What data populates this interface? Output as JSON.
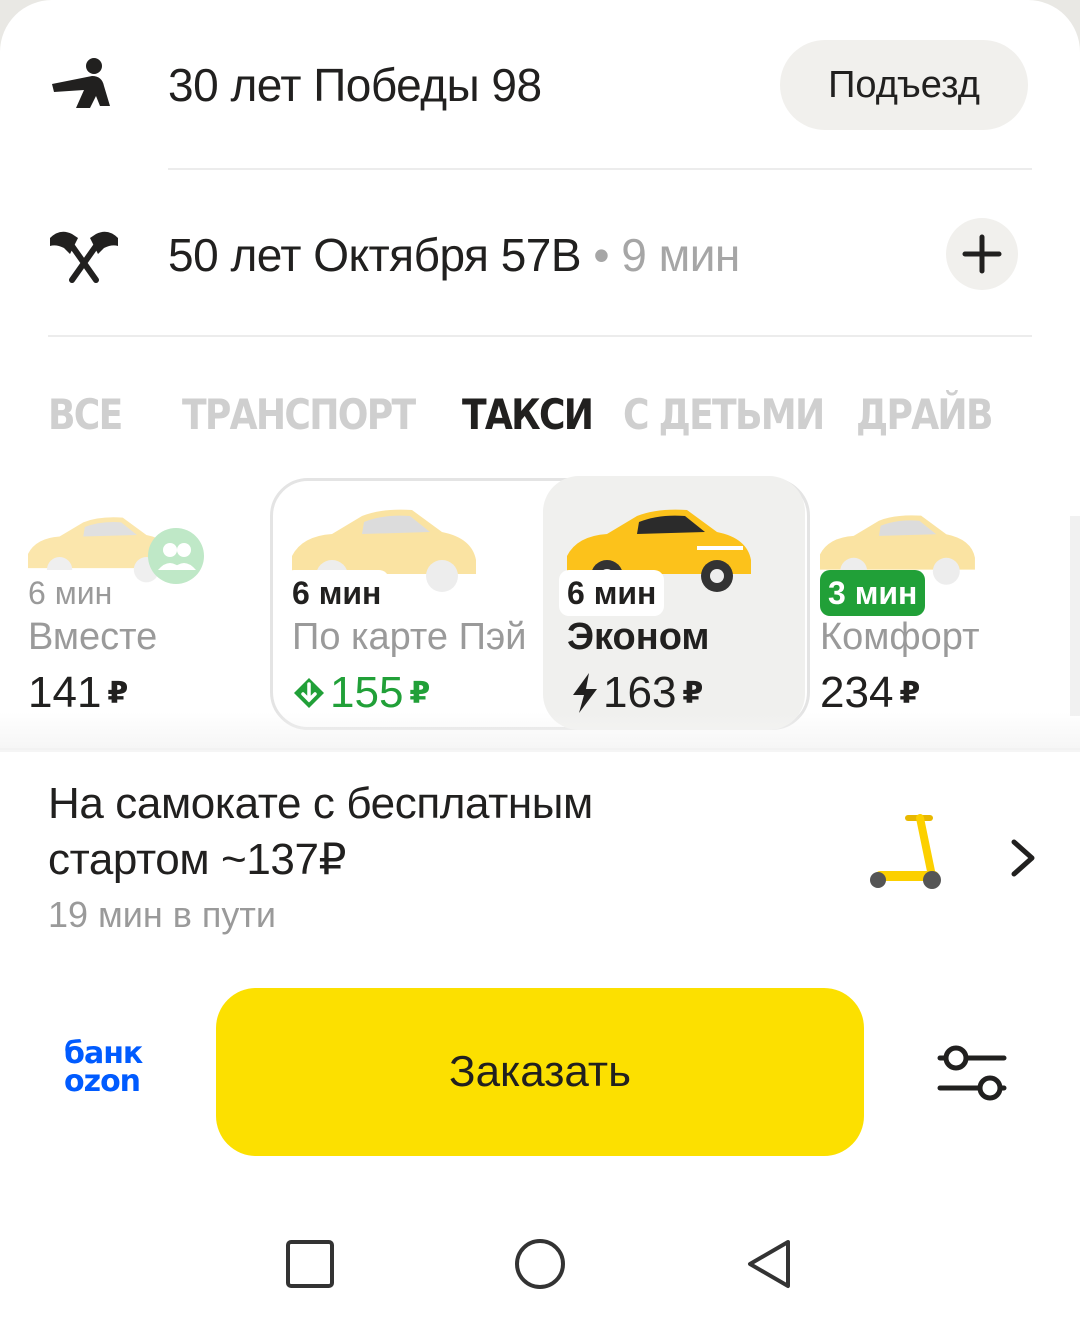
{
  "route": {
    "from": {
      "address": "30 лет Победы 98",
      "action": "Подъезд"
    },
    "to": {
      "address": "50 лет Октября 57В",
      "separator": "•",
      "eta": "9 мин"
    }
  },
  "tabs": [
    {
      "label": "ВСЕ",
      "active": false
    },
    {
      "label": "ТРАНСПОРТ",
      "active": false
    },
    {
      "label": "ТАКСИ",
      "active": true
    },
    {
      "label": "С ДЕТЬМИ",
      "active": false
    },
    {
      "label": "ДРАЙВ",
      "active": false
    }
  ],
  "tariffs": [
    {
      "eta": "6 мин",
      "name": "Вместе",
      "price": "141",
      "currency": "₽",
      "badge": "people-icon"
    },
    {
      "eta": "6 мин",
      "name": "По карте Пэй",
      "price": "155",
      "currency": "₽",
      "badge": "discount-arrow-icon",
      "price_color": "#21a038"
    },
    {
      "eta": "6 мин",
      "name": "Эконом",
      "price": "163",
      "currency": "₽",
      "badge": "lightning-icon",
      "selected": true
    },
    {
      "eta": "3 мин",
      "name": "Комфорт",
      "price": "234",
      "currency": "₽",
      "eta_color": "#21a038"
    }
  ],
  "promo": {
    "title_line1": "На самокате с бесплатным",
    "title_line2": "стартом ~137₽",
    "subtitle": "19 мин в пути"
  },
  "bank": {
    "line1": "банк",
    "line2": "ozon"
  },
  "order_button": "Заказать",
  "colors": {
    "accent": "#fce000",
    "green": "#21a038",
    "ozon": "#005bff",
    "text": "#21201f",
    "muted": "#9a9a9a"
  }
}
